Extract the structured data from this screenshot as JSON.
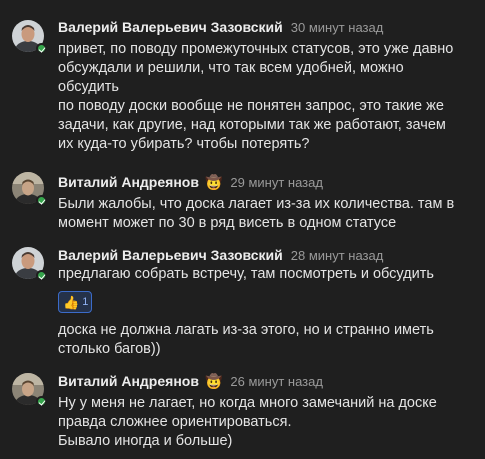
{
  "messages": [
    {
      "author": "Валерий Валерьевич Зазовский",
      "time": "30 минут назад",
      "lines": [
        "привет, по поводу промежуточных статусов, это уже давно",
        "обсуждали и решили, что так всем удобней, можно",
        "обсудить",
        "по поводу доски вообще не понятен запрос, это такие же",
        "задачи, как другие, над которыми так же работают, зачем",
        "их куда-то убирать? чтобы потерять?"
      ]
    },
    {
      "author": "Виталий Андреянов",
      "status_emoji": "🤠",
      "time": "29 минут назад",
      "lines": [
        "Были жалобы, что доска лагает из-за их количества. там в",
        "момент может по 30 в ряд висеть в одном статусе"
      ]
    },
    {
      "author": "Валерий Валерьевич Зазовский",
      "time": "28 минут назад",
      "lines": [
        "предлагаю собрать встречу, там посмотреть и обсудить"
      ],
      "reaction": {
        "emoji": "👍",
        "count": "1"
      },
      "lines_after": [
        "доска не должна лагать из-за этого, но и странно иметь",
        "столько багов))"
      ]
    },
    {
      "author": "Виталий Андреянов",
      "status_emoji": "🤠",
      "time": "26 минут назад",
      "lines": [
        "Ну у меня не лагает, но когда много замечаний на доске",
        "правда сложнее ориентироваться.",
        "Бывало иногда и больше)"
      ]
    }
  ],
  "colors": {
    "background": "#1f1f1f",
    "online": "#35a44b",
    "reaction_border": "#3b6bc9"
  }
}
